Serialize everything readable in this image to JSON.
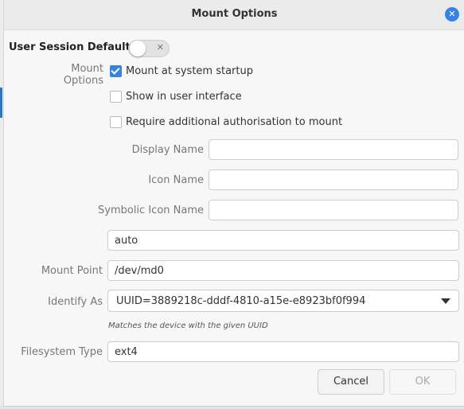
{
  "window": {
    "title": "Mount Options"
  },
  "section": {
    "title": "User Session Defaults"
  },
  "options": {
    "label": "Mount Options",
    "mount_at_startup": {
      "label": "Mount at system startup",
      "checked": true
    },
    "show_in_ui": {
      "label": "Show in user interface",
      "checked": false
    },
    "require_auth": {
      "label": "Require additional authorisation to mount",
      "checked": false
    }
  },
  "fields": {
    "display_name": {
      "label": "Display Name",
      "value": ""
    },
    "icon_name": {
      "label": "Icon Name",
      "value": ""
    },
    "symbolic_icon_name": {
      "label": "Symbolic Icon Name",
      "value": ""
    },
    "options_value": "auto",
    "mount_point": {
      "label": "Mount Point",
      "value": "/dev/md0"
    },
    "identify_as": {
      "label": "Identify As",
      "selected": "UUID=3889218c-dddf-4810-a15e-e8923bf0f994",
      "hint": "Matches the device with the given UUID"
    },
    "filesystem_type": {
      "label": "Filesystem Type",
      "value": "ext4"
    }
  },
  "buttons": {
    "cancel": "Cancel",
    "ok": "OK"
  },
  "icons": {
    "close": "close-icon",
    "dropdown": "chevron-down-icon",
    "toggle_off": "x-icon"
  },
  "colors": {
    "accent": "#3584e4"
  }
}
